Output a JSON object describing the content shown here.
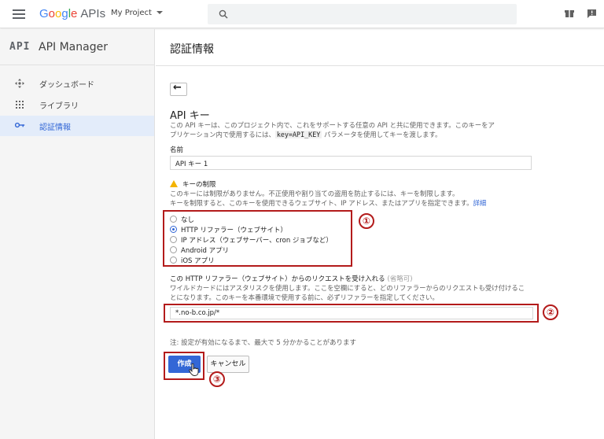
{
  "header": {
    "logo_google": [
      "G",
      "o",
      "o",
      "g",
      "l",
      "e"
    ],
    "logo_apis": "APIs",
    "project": "My Project"
  },
  "sidebar": {
    "api_badge": "API",
    "title": "API Manager",
    "items": [
      {
        "label": "ダッシュボード",
        "icon": "dashboard-icon"
      },
      {
        "label": "ライブラリ",
        "icon": "library-icon"
      },
      {
        "label": "認証情報",
        "icon": "key-icon",
        "active": true
      }
    ]
  },
  "main": {
    "title": "認証情報",
    "back": "←",
    "section_title": "API キー",
    "desc_1": "この API キーは、このプロジェクト内で、これをサポートする任意の API と共に使用できます。このキーをア",
    "desc_2_pre": "プリケーション内で使用するには、",
    "desc_code": "key=API_KEY",
    "desc_2_post": " パラメータを使用してキーを渡します。",
    "name_label": "名前",
    "name_value": "API キー 1",
    "restriction_title": "キーの制限",
    "restriction_desc_1": "このキーには制限がありません。不正使用や割り当ての盗用を防止するには、キーを制限します。",
    "restriction_desc_2": "キーを制限すると、このキーを使用できるウェブサイト、IP アドレス、またはアプリを指定できます。",
    "restriction_link": "詳細",
    "options": [
      {
        "label": "なし",
        "selected": false
      },
      {
        "label": "HTTP リファラー（ウェブサイト）",
        "selected": true
      },
      {
        "label": "IP アドレス（ウェブサーバー、cron ジョブなど）",
        "selected": false
      },
      {
        "label": "Android アプリ",
        "selected": false
      },
      {
        "label": "iOS アプリ",
        "selected": false
      }
    ],
    "referrer_label": "この HTTP リファラー（ウェブサイト）からのリクエストを受け入れる",
    "referrer_optional": "(省略可)",
    "referrer_desc_1": "ワイルドカードにはアスタリスクを使用します。ここを空欄にすると、どのリファラーからのリクエストも受け付けるこ",
    "referrer_desc_2": "とになります。このキーを本番環境で使用する前に、必ずリファラーを指定してください。",
    "referrer_value": "*.no-b.co.jp/*",
    "note": "注: 設定が有効になるまで、最大で 5 分かかることがあります",
    "create_label": "作成",
    "cancel_label": "キャンセル"
  },
  "annotations": {
    "one": "①",
    "two": "②",
    "three": "③",
    "color": "#b31b1b"
  },
  "colors": {
    "accent": "#3367d6",
    "warning": "#f4b400"
  }
}
